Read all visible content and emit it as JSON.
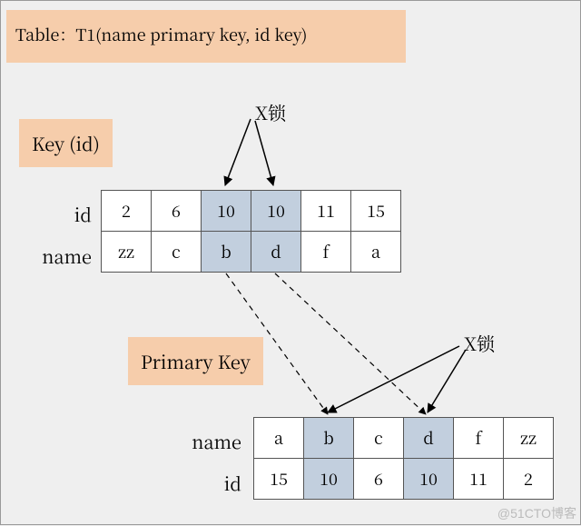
{
  "title": "Table：T1(name primary key, id key)",
  "labels": {
    "key_id": "Key (id)",
    "primary_key": "Primary Key",
    "lock_top": "X锁",
    "lock_bottom": "X锁"
  },
  "top_table": {
    "rows": {
      "id": "id",
      "name": "name"
    },
    "cells": {
      "id": [
        "2",
        "6",
        "10",
        "10",
        "11",
        "15"
      ],
      "name": [
        "zz",
        "c",
        "b",
        "d",
        "f",
        "a"
      ]
    },
    "highlight_cols": [
      2,
      3
    ]
  },
  "bottom_table": {
    "rows": {
      "name": "name",
      "id": "id"
    },
    "cells": {
      "name": [
        "a",
        "b",
        "c",
        "d",
        "f",
        "zz"
      ],
      "id": [
        "15",
        "10",
        "6",
        "10",
        "11",
        "2"
      ]
    },
    "highlight_cols": [
      1,
      3
    ]
  },
  "watermark": "@51CTO博客"
}
